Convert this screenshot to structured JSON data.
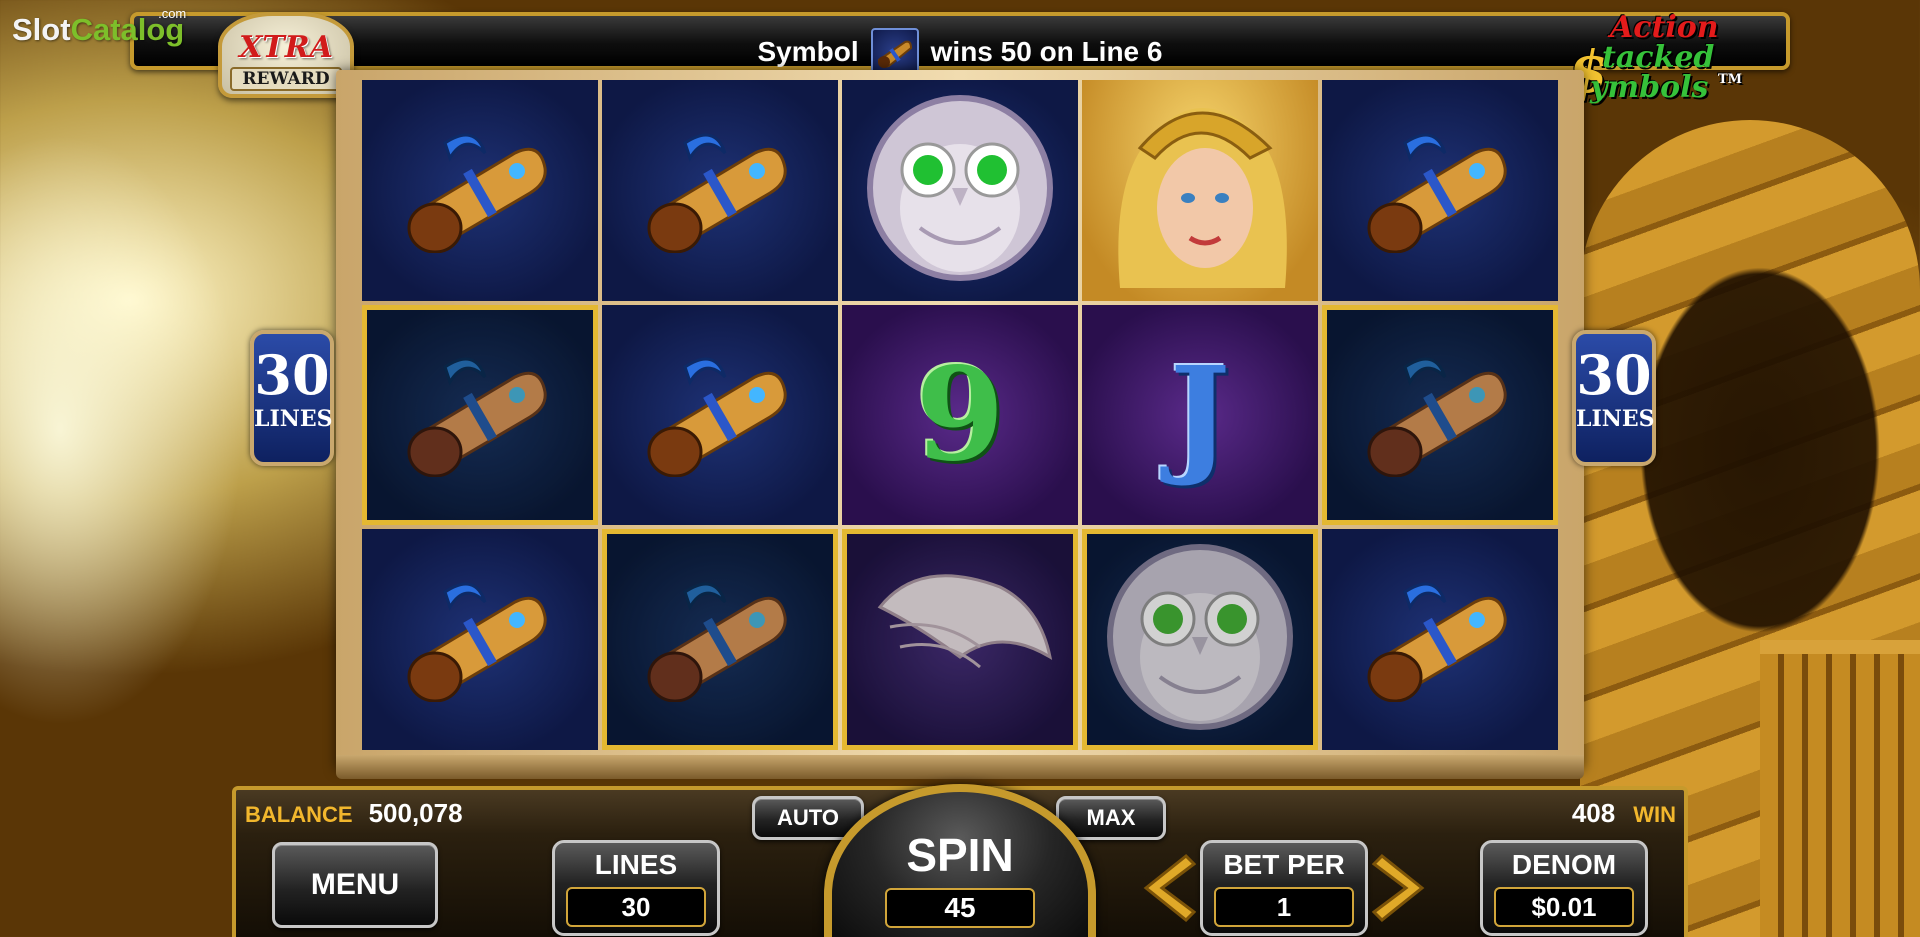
{
  "watermark": {
    "brand_part1": "Slot",
    "brand_part2": "Catalog",
    "suffix": ".com"
  },
  "game_logo": {
    "line1": "XTRA",
    "line2": "REWARD"
  },
  "feature_logo": {
    "line1": "Action",
    "line2": "tacked",
    "line3": "ymbols",
    "dollar": "$",
    "tm": "TM"
  },
  "message": {
    "prefix": "Symbol",
    "suffix": "wins 50 on Line 6",
    "symbol_icon": "horn-icon"
  },
  "side_badges": {
    "lines_count": "30",
    "lines_label": "LINES"
  },
  "reels": {
    "columns": 5,
    "rows": 3,
    "grid": [
      [
        "horn",
        "horn",
        "owl",
        "warrior-woman",
        "horn"
      ],
      [
        "horn",
        "horn",
        "nine",
        "jack",
        "horn"
      ],
      [
        "horn",
        "horn",
        "owl-wings",
        "owl",
        "horn"
      ]
    ],
    "card_labels": {
      "nine": "9",
      "jack": "J"
    },
    "winning_cells": [
      [
        1,
        0
      ],
      [
        2,
        1
      ],
      [
        2,
        2
      ],
      [
        2,
        3
      ],
      [
        1,
        4
      ]
    ],
    "colors": {
      "highlight": "#ffec0a",
      "reel_bg": "#0e1845",
      "purple_bg": "#2a0f4d"
    }
  },
  "panel": {
    "balance_label": "BALANCE",
    "balance_value": "500,078",
    "win_label": "WIN",
    "win_value": "408",
    "menu_label": "MENU",
    "auto_label": "AUTO",
    "max_label": "MAX",
    "lines_label": "LINES",
    "lines_value": "30",
    "spin_label": "SPIN",
    "spin_value": "45",
    "betper_label": "BET PER",
    "betper_value": "1",
    "denom_label": "DENOM",
    "denom_value": "$0.01"
  }
}
